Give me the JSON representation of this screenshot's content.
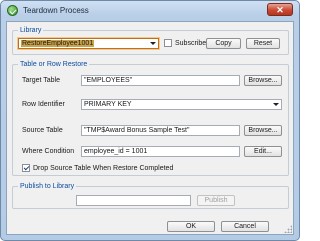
{
  "window": {
    "title": "Teardown Process",
    "close_symbol": "✕"
  },
  "library": {
    "legend": "Library",
    "selected": "RestoreEmployee1001",
    "subscribe_label": "Subscribe",
    "subscribe_checked": false,
    "copy_label": "Copy",
    "reset_label": "Reset"
  },
  "restore": {
    "legend": "Table or Row Restore",
    "target_table_label": "Target Table",
    "target_table_value": "\"EMPLOYEES\"",
    "target_browse": "Browse...",
    "row_identifier_label": "Row Identifier",
    "row_identifier_value": "PRIMARY KEY",
    "source_table_label": "Source Table",
    "source_table_value": "\"TMP$Award Bonus Sample Test\"",
    "source_browse": "Browse...",
    "where_label": "Where Condition",
    "where_value": "employee_id = 1001",
    "edit_label": "Edit...",
    "drop_label": "Drop Source Table When Restore Completed",
    "drop_checked": true
  },
  "publish": {
    "legend": "Publish to Library",
    "input_value": "",
    "publish_label": "Publish"
  },
  "footer": {
    "ok_label": "OK",
    "cancel_label": "Cancel"
  }
}
